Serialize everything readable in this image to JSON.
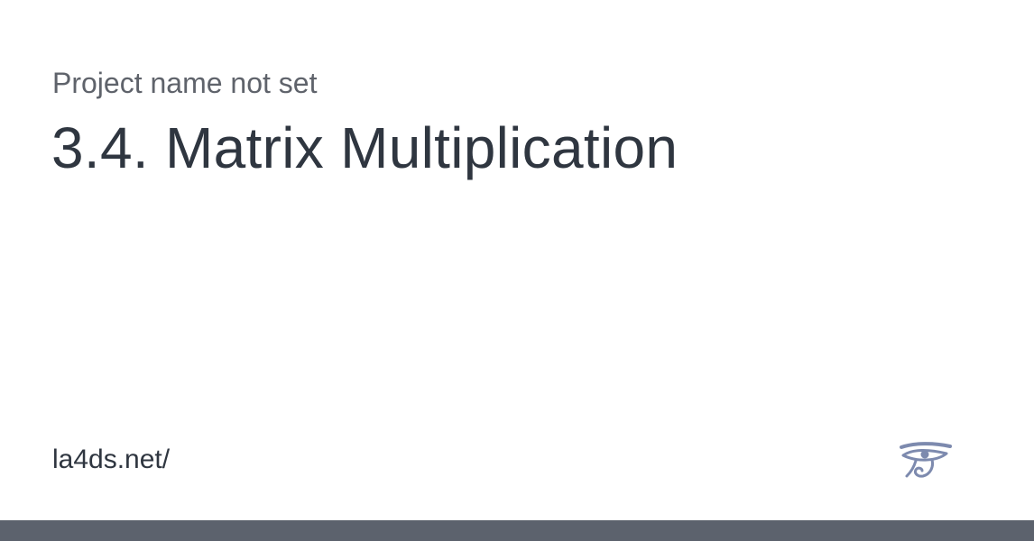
{
  "card": {
    "project_name": "Project name not set",
    "title": "3.4. Matrix Multiplication",
    "url": "la4ds.net/",
    "logo_icon": "eye-of-horus-icon"
  },
  "colors": {
    "background": "#ffffff",
    "title_text": "#2f3640",
    "secondary_text": "#5f636b",
    "logo": "#7d8aae",
    "footer_bar": "#5c626d"
  }
}
